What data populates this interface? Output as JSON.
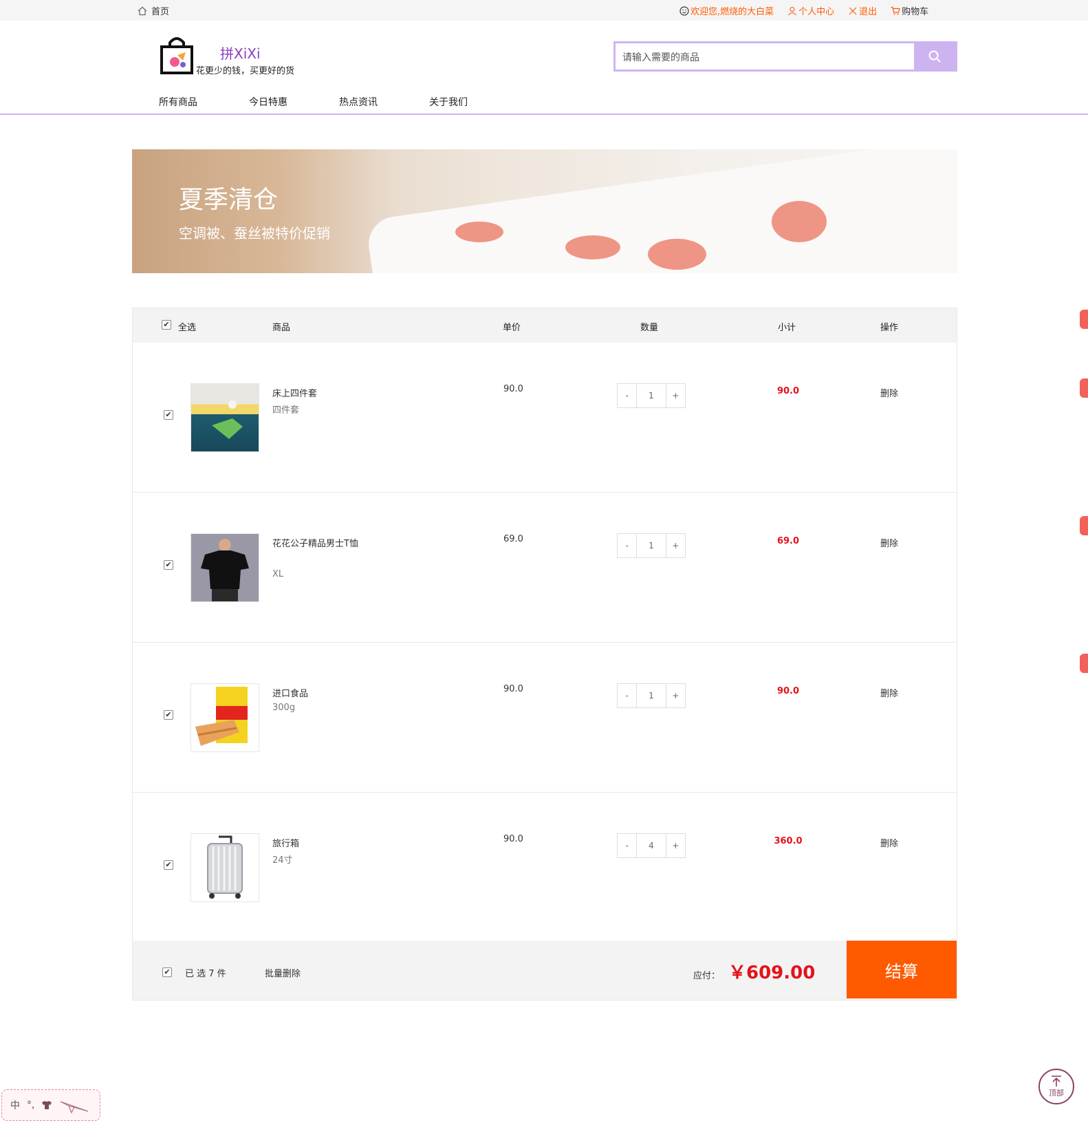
{
  "topbar": {
    "home": "首页",
    "welcome": "欢迎您,燃烧的大白菜",
    "profile": "个人中心",
    "logout": "退出",
    "cart": "购物车"
  },
  "header": {
    "brand": "拼XiXi",
    "slogan": "花更少的钱，买更好的货",
    "search_placeholder": "请输入需要的商品"
  },
  "nav": [
    "所有商品",
    "今日特惠",
    "热点资讯",
    "关于我们"
  ],
  "banner": {
    "title": "夏季清仓",
    "subtitle": "空调被、蚕丝被特价促销"
  },
  "table": {
    "select_all": "全选",
    "col_product": "商品",
    "col_price": "单价",
    "col_qty": "数量",
    "col_subtotal": "小计",
    "col_action": "操作",
    "delete_label": "删除",
    "items": [
      {
        "name": "床上四件套",
        "spec": "四件套",
        "price": "90.0",
        "qty": "1",
        "subtotal": "90.0",
        "checked": true
      },
      {
        "name": "花花公子精品男士T恤",
        "spec": "XL",
        "price": "69.0",
        "qty": "1",
        "subtotal": "69.0",
        "checked": true
      },
      {
        "name": "进口食品",
        "spec": "300g",
        "price": "90.0",
        "qty": "1",
        "subtotal": "90.0",
        "checked": true
      },
      {
        "name": "旅行箱",
        "spec": "24寸",
        "price": "90.0",
        "qty": "4",
        "subtotal": "360.0",
        "checked": true
      }
    ]
  },
  "footer": {
    "selected": "已 选 7 件",
    "bulk_delete": "批量删除",
    "payable_label": "应付：",
    "total": "￥609.00",
    "checkout": "结算"
  },
  "widgets": {
    "ime_lang": "中",
    "ime_punct": "°,",
    "back_to_top": "顶部"
  },
  "colors": {
    "accent_purple": "#cdb4f0",
    "brand_purple": "#8a3fbf",
    "orange": "#ff5a00",
    "price_red": "#e4121b"
  }
}
